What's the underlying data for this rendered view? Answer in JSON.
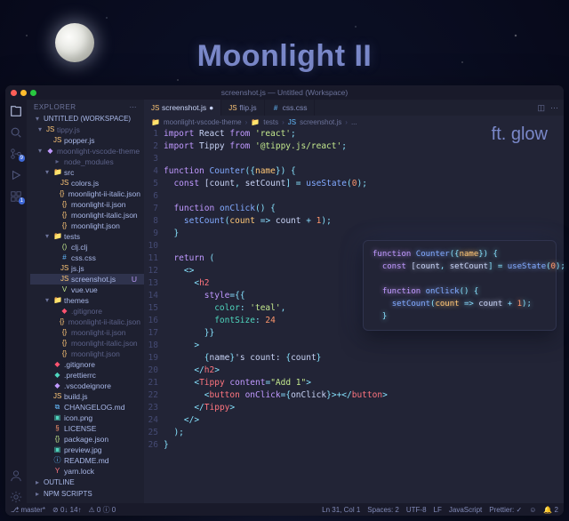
{
  "hero": {
    "title": "Moonlight II",
    "glow_label": "ft. glow"
  },
  "window": {
    "title": "screenshot.js — Untitled (Workspace)"
  },
  "sidebar": {
    "header": "EXPLORER",
    "workspace_label": "UNTITLED (WORKSPACE)",
    "outline_label": "OUTLINE",
    "npm_label": "NPM SCRIPTS"
  },
  "tree": [
    {
      "d": 0,
      "chev": "▾",
      "ico": "JS",
      "icl": "c-yellow",
      "name": "tippy.js",
      "dim": true
    },
    {
      "d": 1,
      "ico": "JS",
      "icl": "c-yellow",
      "name": "popper.js"
    },
    {
      "d": 0,
      "chev": "▾",
      "ico": "◆",
      "icl": "c-purple",
      "name": "moonlight-vscode-theme",
      "dim": true
    },
    {
      "d": 1,
      "ico": "▸",
      "icl": "c-grey",
      "name": "node_modules",
      "dim": true
    },
    {
      "d": 1,
      "chev": "▾",
      "ico": "📁",
      "icl": "c-blue",
      "name": "src"
    },
    {
      "d": 2,
      "ico": "JS",
      "icl": "c-yellow",
      "name": "colors.js"
    },
    {
      "d": 2,
      "ico": "{}",
      "icl": "c-yellow",
      "name": "moonlight-ii-italic.json"
    },
    {
      "d": 2,
      "ico": "{}",
      "icl": "c-yellow",
      "name": "moonlight-ii.json"
    },
    {
      "d": 2,
      "ico": "{}",
      "icl": "c-yellow",
      "name": "moonlight-italic.json"
    },
    {
      "d": 2,
      "ico": "{}",
      "icl": "c-yellow",
      "name": "moonlight.json"
    },
    {
      "d": 1,
      "chev": "▾",
      "ico": "📁",
      "icl": "c-teal",
      "name": "tests"
    },
    {
      "d": 2,
      "ico": "()",
      "icl": "c-green",
      "name": "clj.clj"
    },
    {
      "d": 2,
      "ico": "#",
      "icl": "c-blue",
      "name": "css.css"
    },
    {
      "d": 2,
      "ico": "JS",
      "icl": "c-yellow",
      "name": "js.js"
    },
    {
      "d": 2,
      "ico": "JS",
      "icl": "c-yellow",
      "name": "screenshot.js",
      "sel": true,
      "badge": "U"
    },
    {
      "d": 2,
      "ico": "V",
      "icl": "c-green",
      "name": "vue.vue"
    },
    {
      "d": 1,
      "chev": "▾",
      "ico": "📁",
      "icl": "c-purple",
      "name": "themes"
    },
    {
      "d": 2,
      "ico": "◆",
      "icl": "c-red",
      "name": ".gitignore",
      "dim": true
    },
    {
      "d": 2,
      "ico": "{}",
      "icl": "c-yellow",
      "name": "moonlight-ii-italic.json",
      "dim": true
    },
    {
      "d": 2,
      "ico": "{}",
      "icl": "c-yellow",
      "name": "moonlight-ii.json",
      "dim": true
    },
    {
      "d": 2,
      "ico": "{}",
      "icl": "c-yellow",
      "name": "moonlight-italic.json",
      "dim": true
    },
    {
      "d": 2,
      "ico": "{}",
      "icl": "c-yellow",
      "name": "moonlight.json",
      "dim": true
    },
    {
      "d": 1,
      "ico": "◆",
      "icl": "c-red",
      "name": ".gitignore"
    },
    {
      "d": 1,
      "ico": "◆",
      "icl": "c-teal",
      "name": ".prettierrc"
    },
    {
      "d": 1,
      "ico": "◆",
      "icl": "c-purple",
      "name": ".vscodeignore"
    },
    {
      "d": 1,
      "ico": "JS",
      "icl": "c-yellow",
      "name": "build.js"
    },
    {
      "d": 1,
      "ico": "⧉",
      "icl": "c-blue",
      "name": "CHANGELOG.md"
    },
    {
      "d": 1,
      "ico": "▣",
      "icl": "c-teal",
      "name": "icon.png"
    },
    {
      "d": 1,
      "ico": "§",
      "icl": "c-orange",
      "name": "LICENSE"
    },
    {
      "d": 1,
      "ico": "{}",
      "icl": "c-green",
      "name": "package.json"
    },
    {
      "d": 1,
      "ico": "▣",
      "icl": "c-teal",
      "name": "preview.jpg"
    },
    {
      "d": 1,
      "ico": "ⓘ",
      "icl": "c-blue",
      "name": "README.md"
    },
    {
      "d": 1,
      "ico": "Y",
      "icl": "c-pink",
      "name": "yarn.lock"
    }
  ],
  "tabs": [
    {
      "ico": "JS",
      "icl": "c-yellow",
      "label": "screenshot.js",
      "active": true,
      "mod": true
    },
    {
      "ico": "JS",
      "icl": "c-yellow",
      "label": "flip.js"
    },
    {
      "ico": "#",
      "icl": "c-blue",
      "label": "css.css"
    }
  ],
  "breadcrumbs": [
    "moonlight-vscode-theme",
    "tests",
    "screenshot.js",
    "..."
  ],
  "crumb_icons": [
    "📁",
    "📁",
    "JS",
    ""
  ],
  "code": [
    [
      [
        "kw",
        "import"
      ],
      [
        "var",
        " React "
      ],
      [
        "kw",
        "from"
      ],
      [
        "str",
        " 'react'"
      ],
      [
        "pun",
        ";"
      ]
    ],
    [
      [
        "kw",
        "import"
      ],
      [
        "var",
        " Tippy "
      ],
      [
        "kw",
        "from"
      ],
      [
        "str",
        " '@tippy.js/react'"
      ],
      [
        "pun",
        ";"
      ]
    ],
    [],
    [
      [
        "kw",
        "function"
      ],
      [
        "fn",
        " Counter"
      ],
      [
        "pun",
        "({"
      ],
      [
        "param",
        "name"
      ],
      [
        "pun",
        "}) {"
      ]
    ],
    [
      [
        "var",
        "  "
      ],
      [
        "kw",
        "const"
      ],
      [
        "var",
        " ["
      ],
      [
        "var",
        "count"
      ],
      [
        "pun",
        ", "
      ],
      [
        "var",
        "setCount"
      ],
      [
        "pun",
        "] = "
      ],
      [
        "fn",
        "useState"
      ],
      [
        "pun",
        "("
      ],
      [
        "num",
        "0"
      ],
      [
        "pun",
        ");"
      ]
    ],
    [],
    [
      [
        "var",
        "  "
      ],
      [
        "kw",
        "function"
      ],
      [
        "fn",
        " onClick"
      ],
      [
        "pun",
        "() {"
      ]
    ],
    [
      [
        "var",
        "    "
      ],
      [
        "fn",
        "setCount"
      ],
      [
        "pun",
        "("
      ],
      [
        "param",
        "count"
      ],
      [
        "op",
        " => "
      ],
      [
        "var",
        "count"
      ],
      [
        "op",
        " + "
      ],
      [
        "num",
        "1"
      ],
      [
        "pun",
        ");"
      ]
    ],
    [
      [
        "var",
        "  "
      ],
      [
        "pun",
        "}"
      ]
    ],
    [],
    [
      [
        "var",
        "  "
      ],
      [
        "kw",
        "return"
      ],
      [
        "pun",
        " ("
      ]
    ],
    [
      [
        "var",
        "    "
      ],
      [
        "pun",
        "<>"
      ]
    ],
    [
      [
        "var",
        "      "
      ],
      [
        "pun",
        "<"
      ],
      [
        "tag",
        "h2"
      ]
    ],
    [
      [
        "var",
        "        "
      ],
      [
        "attr",
        "style"
      ],
      [
        "op",
        "="
      ],
      [
        "pun",
        "{{"
      ]
    ],
    [
      [
        "var",
        "          "
      ],
      [
        "prop",
        "color"
      ],
      [
        "pun",
        ": "
      ],
      [
        "str",
        "'teal'"
      ],
      [
        "pun",
        ","
      ]
    ],
    [
      [
        "var",
        "          "
      ],
      [
        "prop",
        "fontSize"
      ],
      [
        "pun",
        ": "
      ],
      [
        "num",
        "24"
      ]
    ],
    [
      [
        "var",
        "        "
      ],
      [
        "pun",
        "}}"
      ]
    ],
    [
      [
        "var",
        "      "
      ],
      [
        "pun",
        ">"
      ]
    ],
    [
      [
        "var",
        "        "
      ],
      [
        "pun",
        "{"
      ],
      [
        "var",
        "name"
      ],
      [
        "pun",
        "}"
      ],
      [
        "var",
        "'s count: "
      ],
      [
        "pun",
        "{"
      ],
      [
        "var",
        "count"
      ],
      [
        "pun",
        "}"
      ]
    ],
    [
      [
        "var",
        "      "
      ],
      [
        "pun",
        "</"
      ],
      [
        "tag",
        "h2"
      ],
      [
        "pun",
        ">"
      ]
    ],
    [
      [
        "var",
        "      "
      ],
      [
        "pun",
        "<"
      ],
      [
        "tag",
        "Tippy"
      ],
      [
        "var",
        " "
      ],
      [
        "attr",
        "content"
      ],
      [
        "op",
        "="
      ],
      [
        "str",
        "\"Add 1\""
      ],
      [
        "pun",
        ">"
      ]
    ],
    [
      [
        "var",
        "        "
      ],
      [
        "pun",
        "<"
      ],
      [
        "tag",
        "button"
      ],
      [
        "var",
        " "
      ],
      [
        "attr",
        "onClick"
      ],
      [
        "op",
        "="
      ],
      [
        "pun",
        "{"
      ],
      [
        "var",
        "onClick"
      ],
      [
        "pun",
        "}>+</"
      ],
      [
        "tag",
        "button"
      ],
      [
        "pun",
        ">"
      ]
    ],
    [
      [
        "var",
        "      "
      ],
      [
        "pun",
        "</"
      ],
      [
        "tag",
        "Tippy"
      ],
      [
        "pun",
        ">"
      ]
    ],
    [
      [
        "var",
        "    "
      ],
      [
        "pun",
        "</>"
      ]
    ],
    [
      [
        "var",
        "  "
      ],
      [
        "pun",
        ");"
      ]
    ],
    [
      [
        "pun",
        "}"
      ]
    ]
  ],
  "callout": [
    [
      [
        "kw",
        "function"
      ],
      [
        "fn",
        " Counter"
      ],
      [
        "pun",
        "({"
      ],
      [
        "param",
        "name"
      ],
      [
        "pun",
        "}) {"
      ]
    ],
    [
      [
        "var",
        "  "
      ],
      [
        "kw",
        "const"
      ],
      [
        "var",
        " ["
      ],
      [
        "var",
        "count"
      ],
      [
        "pun",
        ", "
      ],
      [
        "var",
        "setCount"
      ],
      [
        "pun",
        "] = "
      ],
      [
        "fn",
        "useState"
      ],
      [
        "pun",
        "("
      ],
      [
        "num",
        "0"
      ],
      [
        "pun",
        ");"
      ]
    ],
    [],
    [
      [
        "var",
        "  "
      ],
      [
        "kw",
        "function"
      ],
      [
        "fn",
        " onClick"
      ],
      [
        "pun",
        "() {"
      ]
    ],
    [
      [
        "var",
        "    "
      ],
      [
        "fn",
        "setCount"
      ],
      [
        "pun",
        "("
      ],
      [
        "param",
        "count"
      ],
      [
        "op",
        " => "
      ],
      [
        "var",
        "count"
      ],
      [
        "op",
        " + "
      ],
      [
        "num",
        "1"
      ],
      [
        "pun",
        ");"
      ]
    ],
    [
      [
        "var",
        "  "
      ],
      [
        "pun",
        "}"
      ]
    ]
  ],
  "activity_badges": {
    "scm": "9",
    "ext": "1"
  },
  "status": {
    "branch": "master*",
    "sync": "↻",
    "errors": "⊘ 0↓ 14↑",
    "warnings": "⚠ 0  ⓘ 0",
    "cursor": "Ln 31, Col 1",
    "spaces": "Spaces: 2",
    "encoding": "UTF-8",
    "eol": "LF",
    "lang": "JavaScript",
    "prettier": "Prettier: ✓",
    "feedback": "☺",
    "bell": "🔔 2"
  }
}
